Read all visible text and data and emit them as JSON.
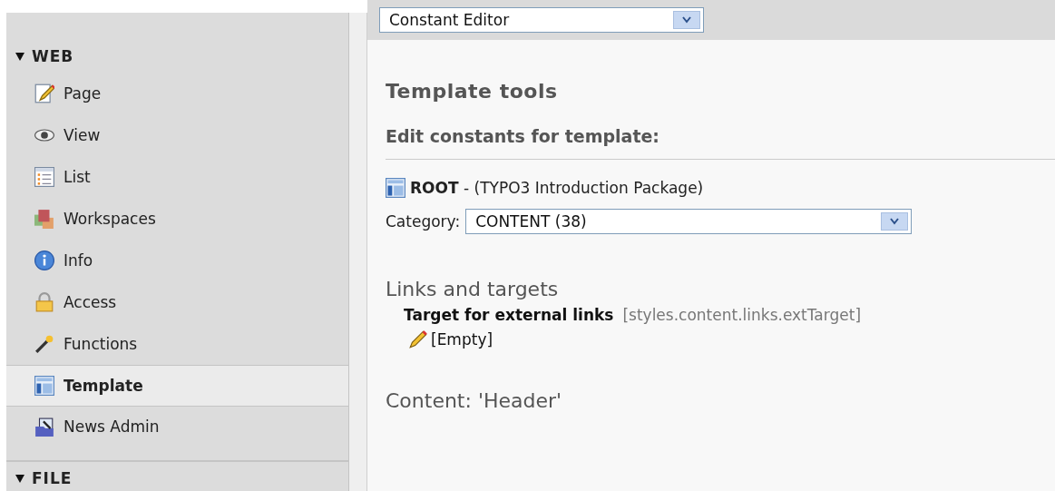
{
  "sidebar": {
    "groups": [
      {
        "title": "WEB",
        "expanded": true,
        "items": [
          {
            "label": "Page",
            "selected": false
          },
          {
            "label": "View",
            "selected": false
          },
          {
            "label": "List",
            "selected": false
          },
          {
            "label": "Workspaces",
            "selected": false
          },
          {
            "label": "Info",
            "selected": false
          },
          {
            "label": "Access",
            "selected": false
          },
          {
            "label": "Functions",
            "selected": false
          },
          {
            "label": "Template",
            "selected": true
          },
          {
            "label": "News Admin",
            "selected": false
          }
        ]
      },
      {
        "title": "FILE",
        "expanded": true
      }
    ]
  },
  "toolbar": {
    "function_select": "Constant Editor"
  },
  "content": {
    "title": "Template tools",
    "subtitle": "Edit constants for template:",
    "template": {
      "name": "ROOT",
      "description": " - (TYPO3 Introduction Package)"
    },
    "category": {
      "label": "Category:",
      "value": "CONTENT (38)"
    },
    "sections": [
      {
        "title": "Links and targets",
        "constants": [
          {
            "label": "Target for external links",
            "key": "[styles.content.links.extTarget]",
            "value": "[Empty]"
          }
        ]
      },
      {
        "title": "Content: 'Header'"
      }
    ]
  }
}
